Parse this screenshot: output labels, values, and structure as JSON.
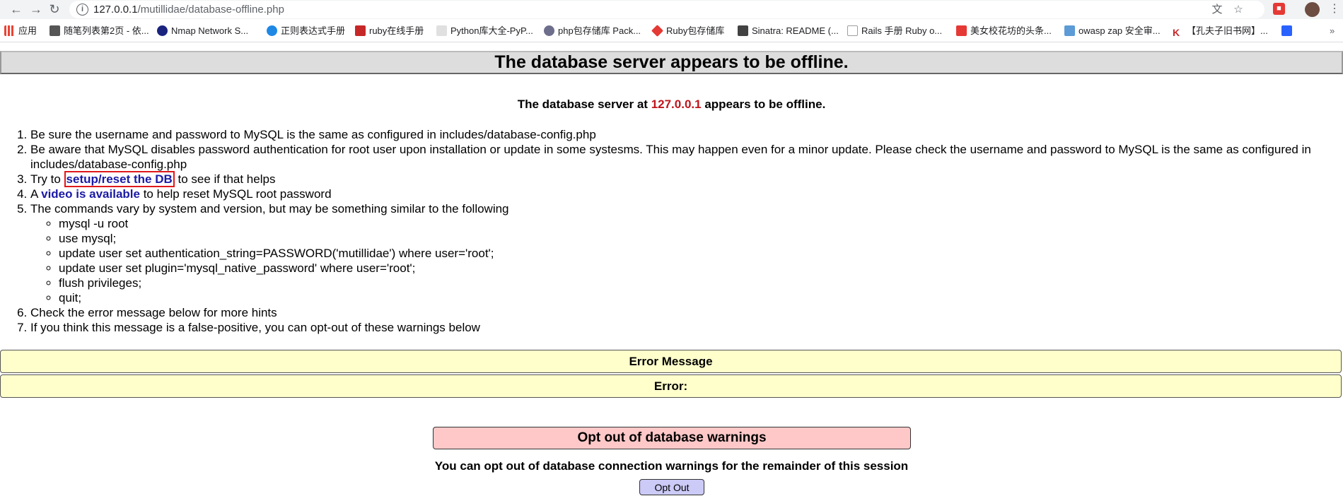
{
  "browser": {
    "url_host": "127.0.0.1",
    "url_path": "/mutillidae/database-offline.php",
    "bookmarks": [
      {
        "label": "应用",
        "color": "#ea4335"
      },
      {
        "label": "随笔列表第2页 - 依...",
        "color": "#555555"
      },
      {
        "label": "Nmap Network S...",
        "color": "#1a237e"
      },
      {
        "label": "正则表达式手册",
        "color": "#1e88e5"
      },
      {
        "label": "ruby在线手册",
        "color": "#c62828"
      },
      {
        "label": "Python库大全-PyP...",
        "color": "#e0e0e0"
      },
      {
        "label": "php包存储库 Pack...",
        "color": "#6d6d8c"
      },
      {
        "label": "Ruby包存储库",
        "color": "#e53935"
      },
      {
        "label": "Sinatra: README (...",
        "color": "#424242"
      },
      {
        "label": "Rails 手册 Ruby o...",
        "color": "#9e9e9e"
      },
      {
        "label": "美女校花坊的头条...",
        "color": "#e53935"
      },
      {
        "label": "owasp zap 安全审...",
        "color": "#5c9bd6"
      },
      {
        "label": "【孔夫子旧书网】...",
        "color": "#c62828"
      },
      {
        "label": "",
        "color": "#2962ff"
      }
    ]
  },
  "page": {
    "title": "The database server appears to be offline.",
    "subtitle_prefix": "The database server at ",
    "subtitle_ip": "127.0.0.1",
    "subtitle_suffix": " appears to be offline.",
    "steps": {
      "s1": "Be sure the username and password to MySQL is the same as configured in includes/database-config.php",
      "s2": "Be aware that MySQL disables password authentication for root user upon installation or update in some systesms. This may happen even for a minor update. Please check the username and password to MySQL is the same as configured in includes/database-config.php",
      "s3_prefix": "Try to ",
      "s3_link": "setup/reset the DB",
      "s3_suffix": " to see if that helps",
      "s4_prefix": "A ",
      "s4_link": "video is available",
      "s4_suffix": " to help reset MySQL root password",
      "s5": "The commands vary by system and version, but may be something similar to the following",
      "commands": [
        "mysql -u root",
        "use mysql;",
        "update user set authentication_string=PASSWORD('mutillidae') where user='root';",
        "update user set plugin='mysql_native_password' where user='root';",
        "flush privileges;",
        "quit;"
      ],
      "s6": "Check the error message below for more hints",
      "s7": "If you think this message is a false-positive, you can opt-out of these warnings below"
    },
    "error_message_header": "Error Message",
    "error_label": "Error:",
    "optout_header": "Opt out of database warnings",
    "optout_text": "You can opt out of database connection warnings for the remainder of this session",
    "optout_button": "Opt Out"
  }
}
